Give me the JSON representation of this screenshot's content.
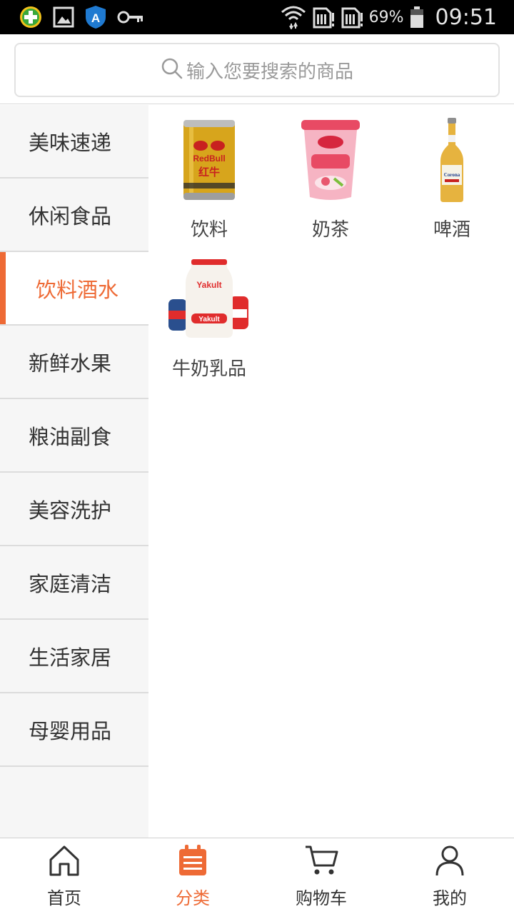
{
  "status_bar": {
    "left_icons": [
      "plus-app-icon",
      "gallery-icon",
      "shield-a-icon",
      "key-icon"
    ],
    "battery_percent": "69%",
    "time": "09:51"
  },
  "search": {
    "placeholder": "输入您要搜索的商品"
  },
  "sidebar": {
    "items": [
      {
        "label": "美味速递"
      },
      {
        "label": "休闲食品"
      },
      {
        "label": "饮料酒水",
        "active": true
      },
      {
        "label": "新鲜水果"
      },
      {
        "label": "粮油副食"
      },
      {
        "label": "美容洗护"
      },
      {
        "label": "家庭清洁"
      },
      {
        "label": "生活家居"
      },
      {
        "label": "母婴用品"
      }
    ]
  },
  "products": [
    {
      "label": "饮料",
      "icon": "red-bull-can-icon"
    },
    {
      "label": "奶茶",
      "icon": "milk-tea-cup-icon"
    },
    {
      "label": "啤酒",
      "icon": "beer-bottle-icon"
    },
    {
      "label": "牛奶乳品",
      "icon": "yakult-bottles-icon"
    }
  ],
  "tabbar": {
    "items": [
      {
        "label": "首页",
        "icon": "home-icon"
      },
      {
        "label": "分类",
        "icon": "category-icon",
        "active": true
      },
      {
        "label": "购物车",
        "icon": "cart-icon"
      },
      {
        "label": "我的",
        "icon": "user-icon"
      }
    ]
  },
  "colors": {
    "accent": "#ee6a35",
    "sidebar_bg": "#f6f6f6",
    "status_bar_bg": "#000000"
  }
}
